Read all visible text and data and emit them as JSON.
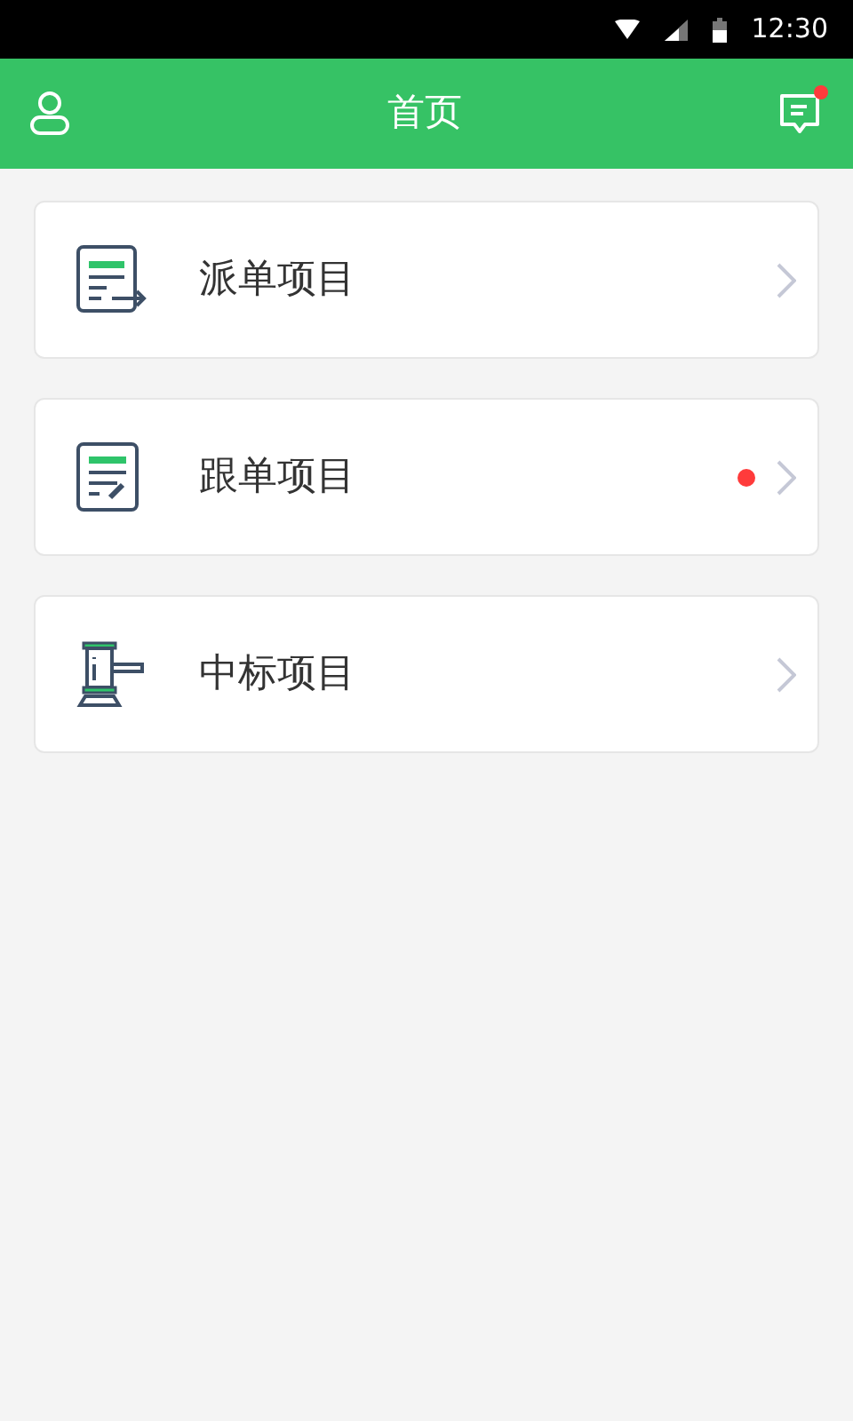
{
  "status_bar": {
    "time": "12:30"
  },
  "header": {
    "title": "首页",
    "messages_unread": true
  },
  "items": [
    {
      "label": "派单项目",
      "kind": "dispatch",
      "unread": false
    },
    {
      "label": "跟单项目",
      "kind": "follow",
      "unread": true
    },
    {
      "label": "中标项目",
      "kind": "award",
      "unread": false
    }
  ]
}
